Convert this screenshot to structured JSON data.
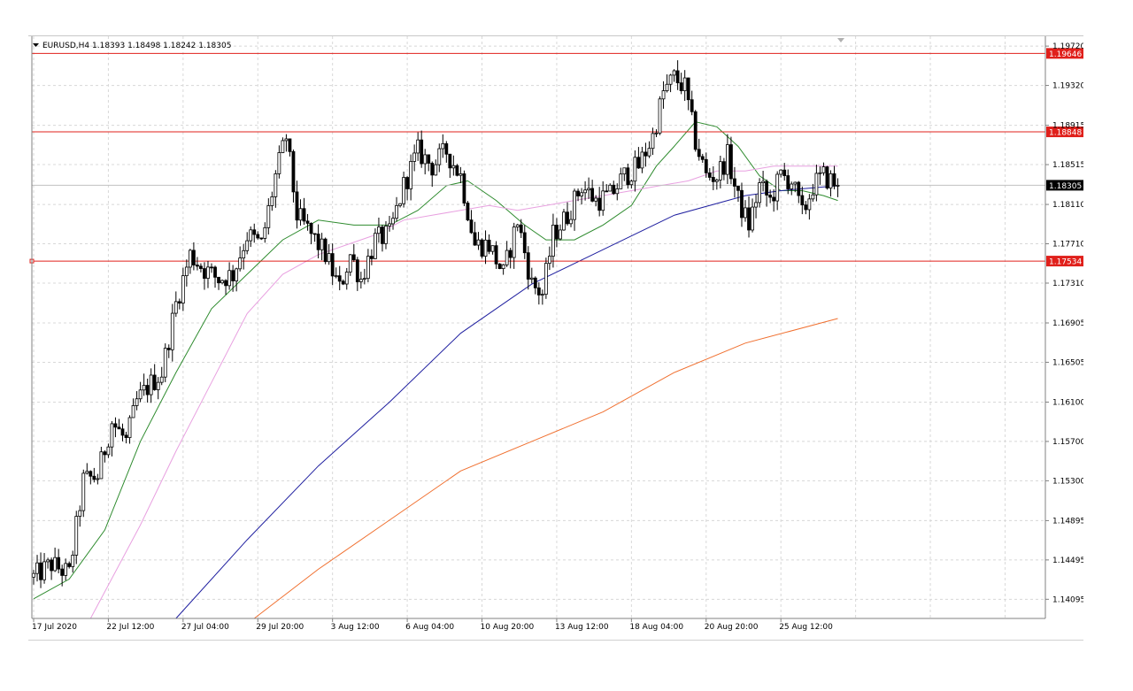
{
  "chart_header": {
    "symbol": "EURUSD,H4",
    "ohlc": "1.18393 1.18498 1.18242 1.18305"
  },
  "chart_data": {
    "type": "candlestick",
    "y_range": [
      1.139,
      1.1982
    ],
    "y_ticks": [
      "1.19720",
      "1.19320",
      "1.18915",
      "1.18515",
      "1.18110",
      "1.17710",
      "1.17310",
      "1.16905",
      "1.16505",
      "1.16100",
      "1.15700",
      "1.15300",
      "1.14895",
      "1.14495",
      "1.14095"
    ],
    "x_ticks": [
      {
        "label": "17 Jul 2020",
        "bar": 0
      },
      {
        "label": "22 Jul 12:00",
        "bar": 21
      },
      {
        "label": "27 Jul 04:00",
        "bar": 42
      },
      {
        "label": "29 Jul 20:00",
        "bar": 63
      },
      {
        "label": "3 Aug 12:00",
        "bar": 84
      },
      {
        "label": "6 Aug 04:00",
        "bar": 105
      },
      {
        "label": "10 Aug 20:00",
        "bar": 126
      },
      {
        "label": "13 Aug 12:00",
        "bar": 147
      },
      {
        "label": "18 Aug 04:00",
        "bar": 168
      },
      {
        "label": "20 Aug 20:00",
        "bar": 189
      },
      {
        "label": "25 Aug 12:00",
        "bar": 210
      }
    ],
    "horizontal_levels": [
      {
        "value": 1.19646,
        "label": "1.19646",
        "color": "#e0201b"
      },
      {
        "value": 1.18848,
        "label": "1.18848",
        "color": "#e0201b"
      },
      {
        "value": 1.17534,
        "label": "1.17534",
        "color": "#e0201b"
      }
    ],
    "current_price": {
      "value": 1.18305,
      "label": "1.18305"
    },
    "colors": {
      "bull": "#ffffff",
      "bear": "#000000",
      "wick": "#000000",
      "grid": "#d8d8d8",
      "level": "#e0201b",
      "ma_green": "#2e8b2e",
      "ma_pink": "#e8a0e0",
      "ma_blue": "#2020a0",
      "ma_orange": "#f07030"
    },
    "anchors": [
      {
        "bar": 0,
        "price": 1.1432
      },
      {
        "bar": 5,
        "price": 1.1445
      },
      {
        "bar": 10,
        "price": 1.1435
      },
      {
        "bar": 14,
        "price": 1.153
      },
      {
        "bar": 18,
        "price": 1.1535
      },
      {
        "bar": 22,
        "price": 1.159
      },
      {
        "bar": 26,
        "price": 1.157
      },
      {
        "bar": 29,
        "price": 1.161
      },
      {
        "bar": 32,
        "price": 1.1625
      },
      {
        "bar": 36,
        "price": 1.164
      },
      {
        "bar": 40,
        "price": 1.171
      },
      {
        "bar": 44,
        "price": 1.176
      },
      {
        "bar": 48,
        "price": 1.1745
      },
      {
        "bar": 52,
        "price": 1.1735
      },
      {
        "bar": 56,
        "price": 1.174
      },
      {
        "bar": 60,
        "price": 1.178
      },
      {
        "bar": 64,
        "price": 1.177
      },
      {
        "bar": 68,
        "price": 1.184
      },
      {
        "bar": 71,
        "price": 1.188
      },
      {
        "bar": 74,
        "price": 1.18
      },
      {
        "bar": 78,
        "price": 1.178
      },
      {
        "bar": 82,
        "price": 1.176
      },
      {
        "bar": 86,
        "price": 1.1725
      },
      {
        "bar": 89,
        "price": 1.176
      },
      {
        "bar": 92,
        "price": 1.1735
      },
      {
        "bar": 96,
        "price": 1.1775
      },
      {
        "bar": 100,
        "price": 1.178
      },
      {
        "bar": 104,
        "price": 1.183
      },
      {
        "bar": 108,
        "price": 1.1865
      },
      {
        "bar": 112,
        "price": 1.185
      },
      {
        "bar": 116,
        "price": 1.1865
      },
      {
        "bar": 120,
        "price": 1.184
      },
      {
        "bar": 124,
        "price": 1.177
      },
      {
        "bar": 128,
        "price": 1.177
      },
      {
        "bar": 132,
        "price": 1.174
      },
      {
        "bar": 136,
        "price": 1.1795
      },
      {
        "bar": 140,
        "price": 1.173
      },
      {
        "bar": 143,
        "price": 1.172
      },
      {
        "bar": 146,
        "price": 1.178
      },
      {
        "bar": 150,
        "price": 1.18
      },
      {
        "bar": 154,
        "price": 1.183
      },
      {
        "bar": 158,
        "price": 1.1815
      },
      {
        "bar": 162,
        "price": 1.182
      },
      {
        "bar": 166,
        "price": 1.184
      },
      {
        "bar": 170,
        "price": 1.185
      },
      {
        "bar": 174,
        "price": 1.188
      },
      {
        "bar": 177,
        "price": 1.1925
      },
      {
        "bar": 180,
        "price": 1.194
      },
      {
        "bar": 183,
        "price": 1.193
      },
      {
        "bar": 186,
        "price": 1.1875
      },
      {
        "bar": 189,
        "price": 1.184
      },
      {
        "bar": 192,
        "price": 1.184
      },
      {
        "bar": 195,
        "price": 1.186
      },
      {
        "bar": 198,
        "price": 1.1815
      },
      {
        "bar": 201,
        "price": 1.179
      },
      {
        "bar": 204,
        "price": 1.183
      },
      {
        "bar": 207,
        "price": 1.1815
      },
      {
        "bar": 210,
        "price": 1.184
      },
      {
        "bar": 213,
        "price": 1.1835
      },
      {
        "bar": 216,
        "price": 1.18
      },
      {
        "bar": 219,
        "price": 1.183
      },
      {
        "bar": 222,
        "price": 1.184
      },
      {
        "bar": 226,
        "price": 1.18305
      }
    ],
    "moving_averages": [
      {
        "color": "#2e8b2e",
        "points": [
          [
            0,
            1.141
          ],
          [
            10,
            1.143
          ],
          [
            20,
            1.148
          ],
          [
            30,
            1.157
          ],
          [
            40,
            1.164
          ],
          [
            50,
            1.1705
          ],
          [
            60,
            1.174
          ],
          [
            70,
            1.1775
          ],
          [
            80,
            1.1795
          ],
          [
            90,
            1.179
          ],
          [
            100,
            1.179
          ],
          [
            108,
            1.1805
          ],
          [
            116,
            1.183
          ],
          [
            122,
            1.1835
          ],
          [
            130,
            1.1815
          ],
          [
            138,
            1.179
          ],
          [
            144,
            1.1775
          ],
          [
            152,
            1.1775
          ],
          [
            160,
            1.179
          ],
          [
            168,
            1.181
          ],
          [
            175,
            1.185
          ],
          [
            180,
            1.187
          ],
          [
            186,
            1.1895
          ],
          [
            192,
            1.189
          ],
          [
            198,
            1.187
          ],
          [
            204,
            1.184
          ],
          [
            210,
            1.1825
          ],
          [
            216,
            1.1825
          ],
          [
            222,
            1.182
          ],
          [
            226,
            1.1815
          ]
        ]
      },
      {
        "color": "#e8a0e0",
        "points": [
          [
            16,
            1.139
          ],
          [
            30,
            1.1485
          ],
          [
            40,
            1.156
          ],
          [
            50,
            1.163
          ],
          [
            60,
            1.17
          ],
          [
            70,
            1.174
          ],
          [
            80,
            1.176
          ],
          [
            88,
            1.177
          ],
          [
            96,
            1.178
          ],
          [
            104,
            1.1795
          ],
          [
            112,
            1.18
          ],
          [
            120,
            1.1805
          ],
          [
            128,
            1.181
          ],
          [
            136,
            1.1805
          ],
          [
            144,
            1.181
          ],
          [
            152,
            1.1815
          ],
          [
            160,
            1.182
          ],
          [
            168,
            1.1825
          ],
          [
            176,
            1.183
          ],
          [
            184,
            1.1835
          ],
          [
            192,
            1.1845
          ],
          [
            200,
            1.1845
          ],
          [
            208,
            1.185
          ],
          [
            216,
            1.185
          ],
          [
            226,
            1.185
          ]
        ]
      },
      {
        "color": "#2020a0",
        "points": [
          [
            40,
            1.139
          ],
          [
            60,
            1.147
          ],
          [
            80,
            1.1545
          ],
          [
            100,
            1.161
          ],
          [
            120,
            1.168
          ],
          [
            140,
            1.173
          ],
          [
            160,
            1.1765
          ],
          [
            180,
            1.18
          ],
          [
            200,
            1.182
          ],
          [
            210,
            1.1825
          ],
          [
            226,
            1.183
          ]
        ]
      },
      {
        "color": "#f07030",
        "points": [
          [
            62,
            1.139
          ],
          [
            80,
            1.144
          ],
          [
            100,
            1.149
          ],
          [
            120,
            1.154
          ],
          [
            140,
            1.157
          ],
          [
            160,
            1.16
          ],
          [
            180,
            1.164
          ],
          [
            200,
            1.167
          ],
          [
            226,
            1.1695
          ]
        ]
      }
    ]
  }
}
